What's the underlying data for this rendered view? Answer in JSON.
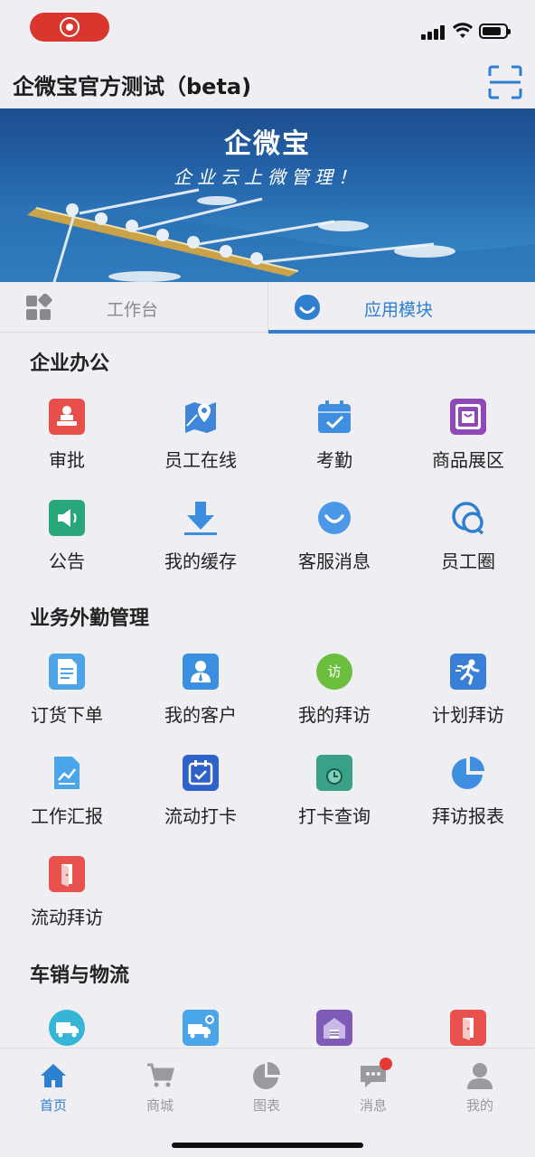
{
  "header": {
    "title": "企微宝官方测试（beta)",
    "scan_icon": "scan-icon"
  },
  "banner": {
    "logo": "企微宝",
    "slogan": "企业云上微管理！"
  },
  "tabs": [
    {
      "label": "工作台",
      "icon": "grid-icon",
      "active": false
    },
    {
      "label": "应用模块",
      "icon": "apps-icon",
      "active": true
    }
  ],
  "sections": [
    {
      "title": "企业办公",
      "items": [
        {
          "label": "审批",
          "icon": "stamp-icon",
          "color": "#e84e4a"
        },
        {
          "label": "员工在线",
          "icon": "map-icon",
          "color": "#3f86d8"
        },
        {
          "label": "考勤",
          "icon": "calendar-check-icon",
          "color": "#3f8ee0"
        },
        {
          "label": "商品展区",
          "icon": "shopping-bag-icon",
          "color": "#8e48b8"
        },
        {
          "label": "公告",
          "icon": "speaker-icon",
          "color": "#28a87a"
        },
        {
          "label": "我的缓存",
          "icon": "download-icon",
          "color": "#3b8de0"
        },
        {
          "label": "客服消息",
          "icon": "chat-smile-icon",
          "color": "#4b97e8"
        },
        {
          "label": "员工圈",
          "icon": "bubbles-icon",
          "color": "#2f7fd0"
        }
      ]
    },
    {
      "title": "业务外勤管理",
      "items": [
        {
          "label": "订货下单",
          "icon": "order-doc-icon",
          "color": "#4da4e8"
        },
        {
          "label": "我的客户",
          "icon": "customer-icon",
          "color": "#3a8fe0"
        },
        {
          "label": "我的拜访",
          "icon": "visit-icon",
          "color": "#6cbf3c",
          "text": "访"
        },
        {
          "label": "计划拜访",
          "icon": "runner-icon",
          "color": "#3a7fd6"
        },
        {
          "label": "工作汇报",
          "icon": "report-icon",
          "color": "#4aa6e8"
        },
        {
          "label": "流动打卡",
          "icon": "checkin-icon",
          "color": "#2e62c8"
        },
        {
          "label": "打卡查询",
          "icon": "checkin-query-icon",
          "color": "#3aa189"
        },
        {
          "label": "拜访报表",
          "icon": "pie-icon",
          "color": "#3f8ee0"
        },
        {
          "label": "流动拜访",
          "icon": "door-icon",
          "color": "#e8524e"
        }
      ]
    },
    {
      "title": "车销与物流",
      "items": [
        {
          "label": "",
          "icon": "truck-round-icon",
          "color": "#36b6d6"
        },
        {
          "label": "",
          "icon": "truck-gear-icon",
          "color": "#4aa6e8"
        },
        {
          "label": "",
          "icon": "warehouse-icon",
          "color": "#7e5bb6"
        },
        {
          "label": "",
          "icon": "door-icon",
          "color": "#e8524e"
        }
      ]
    }
  ],
  "tabbar": [
    {
      "label": "首页",
      "icon": "home-icon",
      "active": true
    },
    {
      "label": "商城",
      "icon": "cart-icon",
      "active": false
    },
    {
      "label": "图表",
      "icon": "pie-chart-icon",
      "active": false
    },
    {
      "label": "消息",
      "icon": "message-icon",
      "active": false,
      "badge": true
    },
    {
      "label": "我的",
      "icon": "user-icon",
      "active": false
    }
  ],
  "colors": {
    "accent": "#2f7fd0",
    "background": "#efeef3",
    "record": "#d9362d"
  }
}
